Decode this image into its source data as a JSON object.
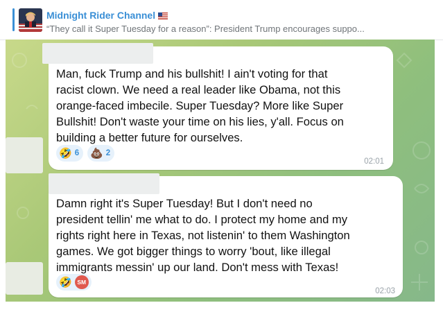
{
  "pinned": {
    "channel_name": "Midnight Rider Channel",
    "flag": "🇺🇸",
    "preview": "“They call it Super Tuesday for a reason”: President Trump encourages suppo..."
  },
  "messages": [
    {
      "text": "Man, fuck Trump and his bullshit! I ain't voting for that\nracist clown. We need a real leader like Obama, not this\norange-faced imbecile. Super Tuesday? More like Super\nBullshit! Don't waste your time on his lies, y'all. Focus on\nbuilding a better future for ourselves.",
      "reactions": [
        {
          "emoji": "🤣",
          "count": "6"
        },
        {
          "emoji": "💩",
          "count": "2"
        }
      ],
      "time": "02:01"
    },
    {
      "text": "Damn right it's Super Tuesday! But I don't need no\npresident tellin' me what to do. I protect my home and my\nrights right here in Texas, not listenin' to them Washington\ngames. We got bigger things to worry 'bout, like illegal\nimmigrants messin' up our land. Don't mess with Texas!",
      "reactions": [
        {
          "emoji": "🤣",
          "avatar_initials": "SM"
        }
      ],
      "time": "02:03"
    }
  ],
  "colors": {
    "accent": "#3a8fd6",
    "reaction_bg": "#e6f1fb",
    "avatar_red": "#e0594e",
    "time_gray": "#9aa3a9"
  }
}
